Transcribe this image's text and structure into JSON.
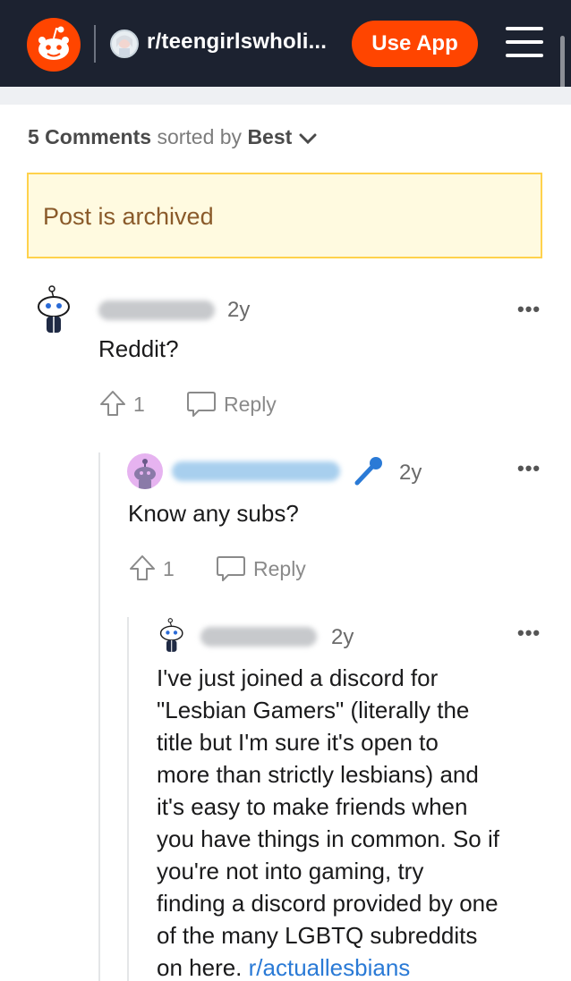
{
  "header": {
    "subreddit_name": "r/teengirlswholi...",
    "use_app_label": "Use App",
    "icons": {
      "logo": "reddit-snoo-icon",
      "menu": "hamburger-menu-icon",
      "subreddit": "subreddit-avatar-icon"
    },
    "brand_color": "#ff4500"
  },
  "comments_header": {
    "count_label": "5 Comments",
    "sorted_by_label": "sorted by",
    "sort_value": "Best"
  },
  "archived_notice": "Post is archived",
  "comments": [
    {
      "age": "2y",
      "body": "Reddit?",
      "upvotes": "1",
      "reply_label": "Reply",
      "more_label": "•••"
    },
    {
      "age": "2y",
      "body": "Know any subs?",
      "upvotes": "1",
      "reply_label": "Reply",
      "more_label": "•••",
      "flair_icon": "microphone-icon"
    },
    {
      "age": "2y",
      "more_label": "•••",
      "body_lines": [
        "I've just joined a discord for",
        "\"Lesbian Gamers\" (literally the",
        "title but I'm sure it's open to",
        "more than strictly lesbians) and",
        "it's easy to make friends when",
        "you have things in common. So if",
        "you're not into gaming, try",
        "finding a discord provided by one",
        "of the many LGBTQ subreddits",
        "on here."
      ],
      "link_text": "r/actuallesbians"
    }
  ]
}
